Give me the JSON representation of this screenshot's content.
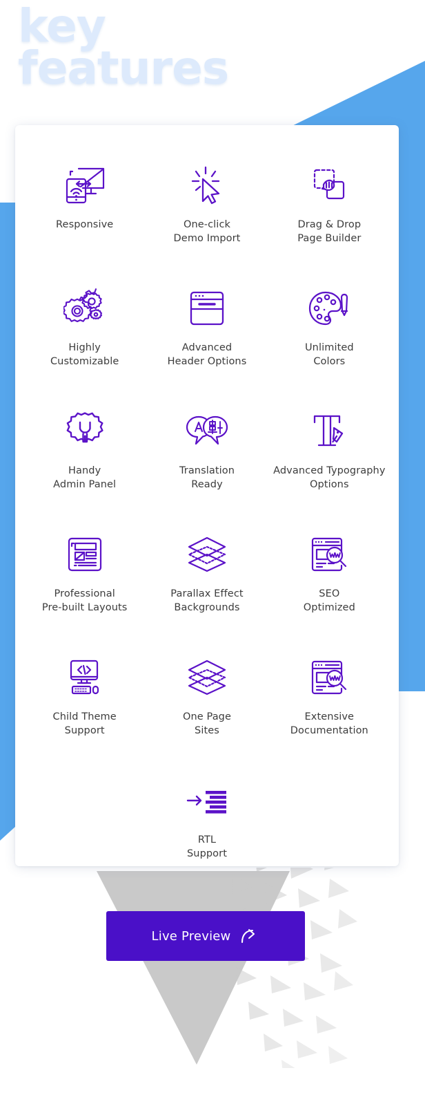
{
  "page": {
    "title": "key\nfeatures",
    "title_color": "#ddeafc",
    "background_color": "#ffffff",
    "accent_blue": "#56a6ec",
    "icon_purple": "#5b12c8",
    "label_color": "#3c3c3c",
    "shatter_gray": "#c9c9c9"
  },
  "card": {
    "features": [
      {
        "icon": "responsive-devices-icon",
        "label": "Responsive"
      },
      {
        "icon": "cursor-click-icon",
        "label": "One-click\nDemo Import"
      },
      {
        "icon": "drag-drop-icon",
        "label": "Drag & Drop\nPage Builder"
      },
      {
        "icon": "gears-icon",
        "label": "Highly\nCustomizable"
      },
      {
        "icon": "browser-header-icon",
        "label": "Advanced\nHeader Options"
      },
      {
        "icon": "color-palette-icon",
        "label": "Unlimited\nColors"
      },
      {
        "icon": "gear-wrench-icon",
        "label": "Handy\nAdmin Panel"
      },
      {
        "icon": "translation-bubbles-icon",
        "label": "Translation\nReady"
      },
      {
        "icon": "typography-pen-icon",
        "label": "Advanced Typography\nOptions"
      },
      {
        "icon": "layout-wireframe-icon",
        "label": "Professional\nPre-built Layouts"
      },
      {
        "icon": "layers-stack-icon",
        "label": "Parallax Effect\nBackgrounds"
      },
      {
        "icon": "seo-search-icon",
        "label": "SEO\nOptimized"
      },
      {
        "icon": "code-monitor-icon",
        "label": "Child Theme\nSupport"
      },
      {
        "icon": "layers-stack-icon",
        "label": "One Page\nSites"
      },
      {
        "icon": "seo-search-icon",
        "label": "Extensive\nDocumentation"
      },
      {
        "icon": "rtl-arrow-lines-icon",
        "label": "RTL\nSupport"
      }
    ]
  },
  "cta": {
    "label": "Live Preview",
    "icon": "share-arrow-icon",
    "background_color": "#4a10c8",
    "text_color": "#ffffff"
  }
}
